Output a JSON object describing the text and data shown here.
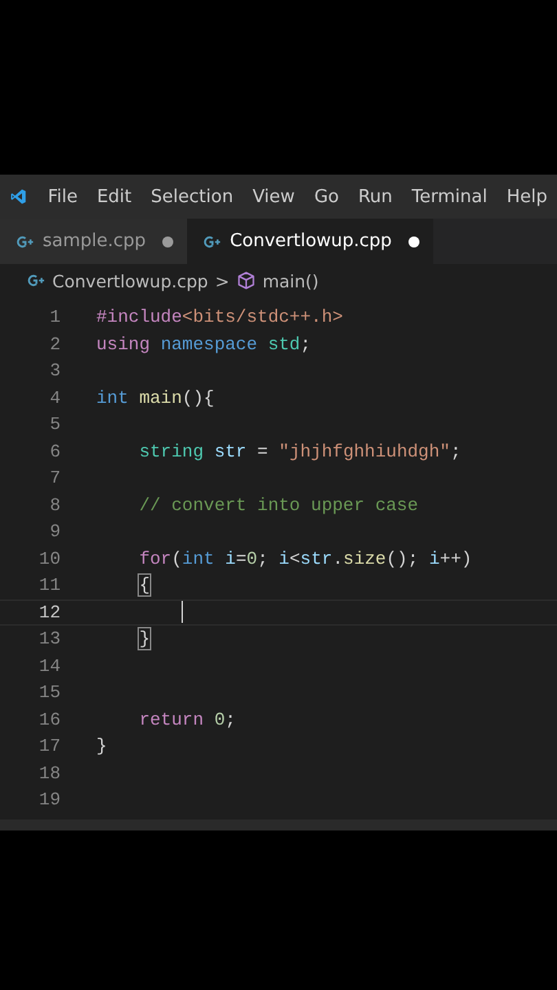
{
  "menu_bar": {
    "items": [
      "File",
      "Edit",
      "Selection",
      "View",
      "Go",
      "Run",
      "Terminal",
      "Help"
    ]
  },
  "tabs": [
    {
      "label": "sample.cpp",
      "modified": true,
      "selected": false
    },
    {
      "label": "Convertlowup.cpp",
      "modified": true,
      "selected": true
    }
  ],
  "breadcrumb": {
    "file": "Convertlowup.cpp",
    "separator": ">",
    "symbol": "main()"
  },
  "code_lines": [
    {
      "number": "1",
      "current": false,
      "tokens": [
        {
          "text": "#include",
          "kind": "keyword"
        },
        {
          "text": "<bits/stdc++.h>",
          "kind": "string"
        }
      ]
    },
    {
      "number": "2",
      "current": false,
      "tokens": [
        {
          "text": "using",
          "kind": "keyword"
        },
        {
          "text": " namespace",
          "kind": "type"
        },
        {
          "text": " std",
          "kind": "namespace"
        },
        {
          "text": ";",
          "kind": "plain"
        }
      ]
    },
    {
      "number": "3",
      "current": false
    },
    {
      "number": "4",
      "current": false,
      "tokens": [
        {
          "text": "int",
          "kind": "type"
        },
        {
          "text": " main",
          "kind": "function"
        },
        {
          "text": "(){",
          "kind": "plain"
        }
      ]
    },
    {
      "number": "5",
      "current": false
    },
    {
      "number": "6",
      "current": false,
      "tokens": [
        {
          "text": "    string",
          "kind": "namespace"
        },
        {
          "text": " str",
          "kind": "variable"
        },
        {
          "text": " = ",
          "kind": "plain"
        },
        {
          "text": "\"jhjhfghhiuhdgh\"",
          "kind": "string"
        },
        {
          "text": ";",
          "kind": "plain"
        }
      ]
    },
    {
      "number": "7",
      "current": false
    },
    {
      "number": "8",
      "current": false,
      "tokens": [
        {
          "text": "    // convert into upper case",
          "kind": "comment"
        }
      ]
    },
    {
      "number": "9",
      "current": false
    },
    {
      "number": "10",
      "current": false,
      "tokens": [
        {
          "text": "    for",
          "kind": "keyword"
        },
        {
          "text": "(",
          "kind": "plain"
        },
        {
          "text": "int",
          "kind": "type"
        },
        {
          "text": " i",
          "kind": "variable"
        },
        {
          "text": "=",
          "kind": "plain"
        },
        {
          "text": "0",
          "kind": "number"
        },
        {
          "text": "; ",
          "kind": "plain"
        },
        {
          "text": "i",
          "kind": "variable"
        },
        {
          "text": "<",
          "kind": "plain"
        },
        {
          "text": "str",
          "kind": "variable"
        },
        {
          "text": ".",
          "kind": "plain"
        },
        {
          "text": "size",
          "kind": "function"
        },
        {
          "text": "(); ",
          "kind": "plain"
        },
        {
          "text": "i",
          "kind": "variable"
        },
        {
          "text": "++)",
          "kind": "plain"
        }
      ]
    },
    {
      "number": "11",
      "current": false,
      "tokens": [
        {
          "text": "{",
          "kind": "bracket-match"
        }
      ]
    },
    {
      "number": "12",
      "current": true
    },
    {
      "number": "13",
      "current": false,
      "tokens": [
        {
          "text": "}",
          "kind": "bracket-match"
        }
      ]
    },
    {
      "number": "14",
      "current": false
    },
    {
      "number": "15",
      "current": false
    },
    {
      "number": "16",
      "current": false,
      "tokens": [
        {
          "text": "    return",
          "kind": "keyword"
        },
        {
          "text": " 0",
          "kind": "number"
        },
        {
          "text": ";",
          "kind": "plain"
        }
      ]
    },
    {
      "number": "17",
      "current": false,
      "tokens": [
        {
          "text": "}",
          "kind": "plain"
        }
      ]
    },
    {
      "number": "18",
      "current": false
    },
    {
      "number": "19",
      "current": false
    }
  ]
}
